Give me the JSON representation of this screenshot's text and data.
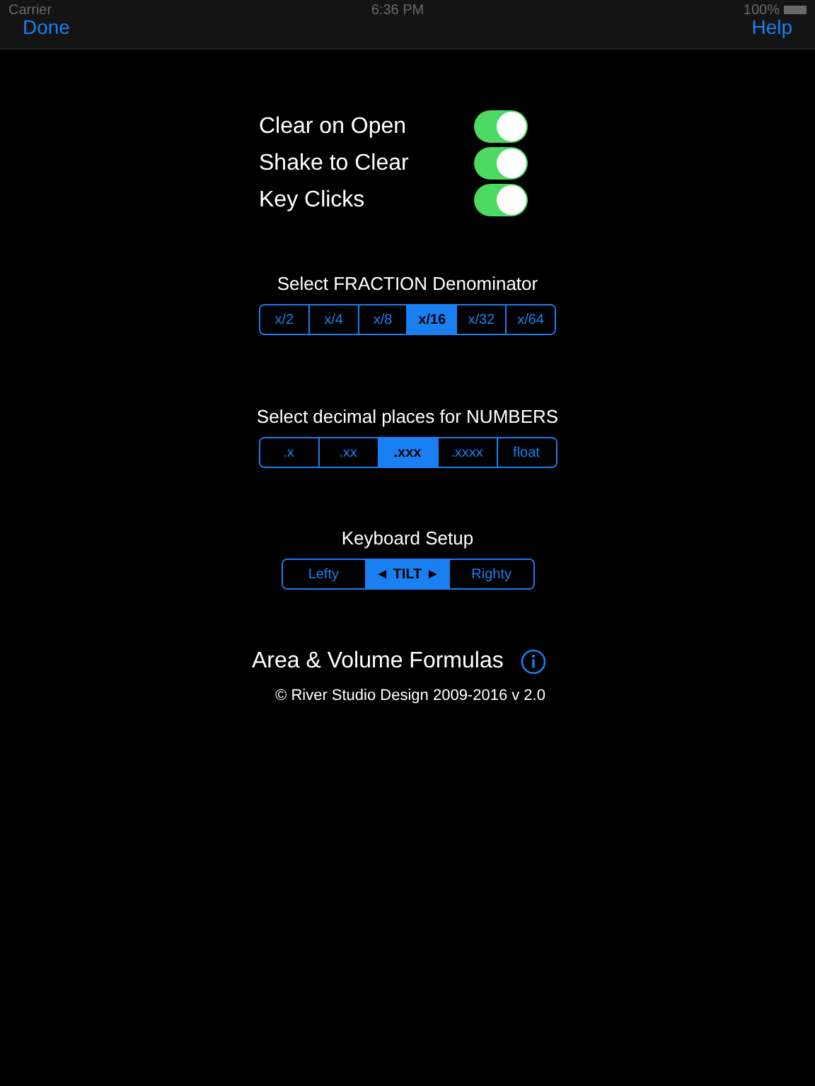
{
  "status_bar": {
    "carrier": "Carrier",
    "time": "6:36 PM",
    "battery": "100%"
  },
  "nav_bar": {
    "left_button": "Done",
    "right_button": "Help"
  },
  "toggles": [
    {
      "label": "Clear on Open",
      "on": true
    },
    {
      "label": "Shake to Clear",
      "on": true
    },
    {
      "label": "Key Clicks",
      "on": true
    }
  ],
  "segment_groups": [
    {
      "title": "Select FRACTION Denominator",
      "segments": [
        {
          "label": "x/2",
          "selected": false
        },
        {
          "label": "x/4",
          "selected": false
        },
        {
          "label": "x/8",
          "selected": false
        },
        {
          "label": "x/16",
          "selected": true
        },
        {
          "label": "x/32",
          "selected": false
        },
        {
          "label": "x/64",
          "selected": false
        }
      ]
    },
    {
      "title": "Select decimal places for NUMBERS",
      "segments": [
        {
          "label": ".x",
          "selected": false
        },
        {
          "label": ".xx",
          "selected": false
        },
        {
          "label": ".xxx",
          "selected": true
        },
        {
          "label": ".xxxx",
          "selected": false
        },
        {
          "label": "float",
          "selected": false
        }
      ]
    },
    {
      "title": "Keyboard Setup",
      "segments": [
        {
          "label": "Lefty",
          "selected": false
        },
        {
          "label": "◄ TILT ►",
          "selected": true
        },
        {
          "label": "Righty",
          "selected": false
        }
      ]
    }
  ],
  "formulas_link": "Area & Volume Formulas",
  "copyright": "© River Studio Design 2009-2016  v 2.0"
}
